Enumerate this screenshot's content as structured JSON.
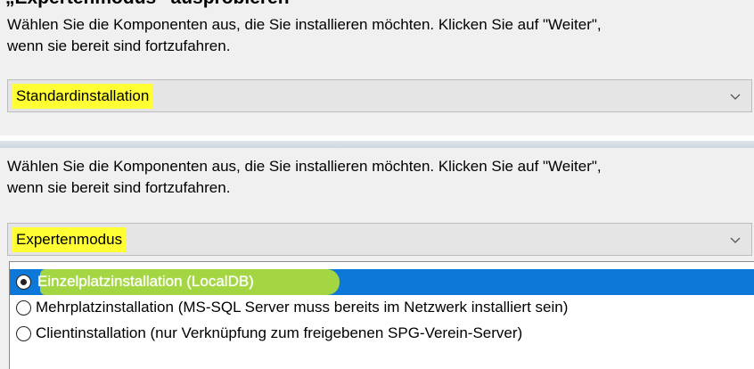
{
  "cut_heading": "„Expertenmodus“ ausprobieren",
  "panel_top": {
    "instruction": "Wählen Sie die Komponenten aus, die Sie installieren möchten. Klicken Sie auf \"Weiter\",\nwenn sie bereit sind fortzufahren.",
    "combo_value": "Standardinstallation",
    "combo_icon": "chevron-down-icon"
  },
  "panel_bottom": {
    "instruction": "Wählen Sie die Komponenten aus, die Sie installieren möchten. Klicken Sie auf \"Weiter\",\nwenn sie bereit sind fortzufahren.",
    "combo_value": "Expertenmodus",
    "combo_icon": "chevron-down-icon",
    "options": [
      {
        "label": "Einzelplatzinstallation (LocalDB)",
        "selected": true
      },
      {
        "label": "Mehrplatzinstallation (MS-SQL Server muss bereits im Netzwerk installiert sein)",
        "selected": false
      },
      {
        "label": "Clientinstallation (nur Verknüpfung zum freigebenen SPG-Verein-Server)",
        "selected": false
      }
    ]
  },
  "colors": {
    "highlight": "#ffff33",
    "selection": "#0d78d7",
    "marker": "#bee628",
    "background": "#f0f0f0"
  }
}
